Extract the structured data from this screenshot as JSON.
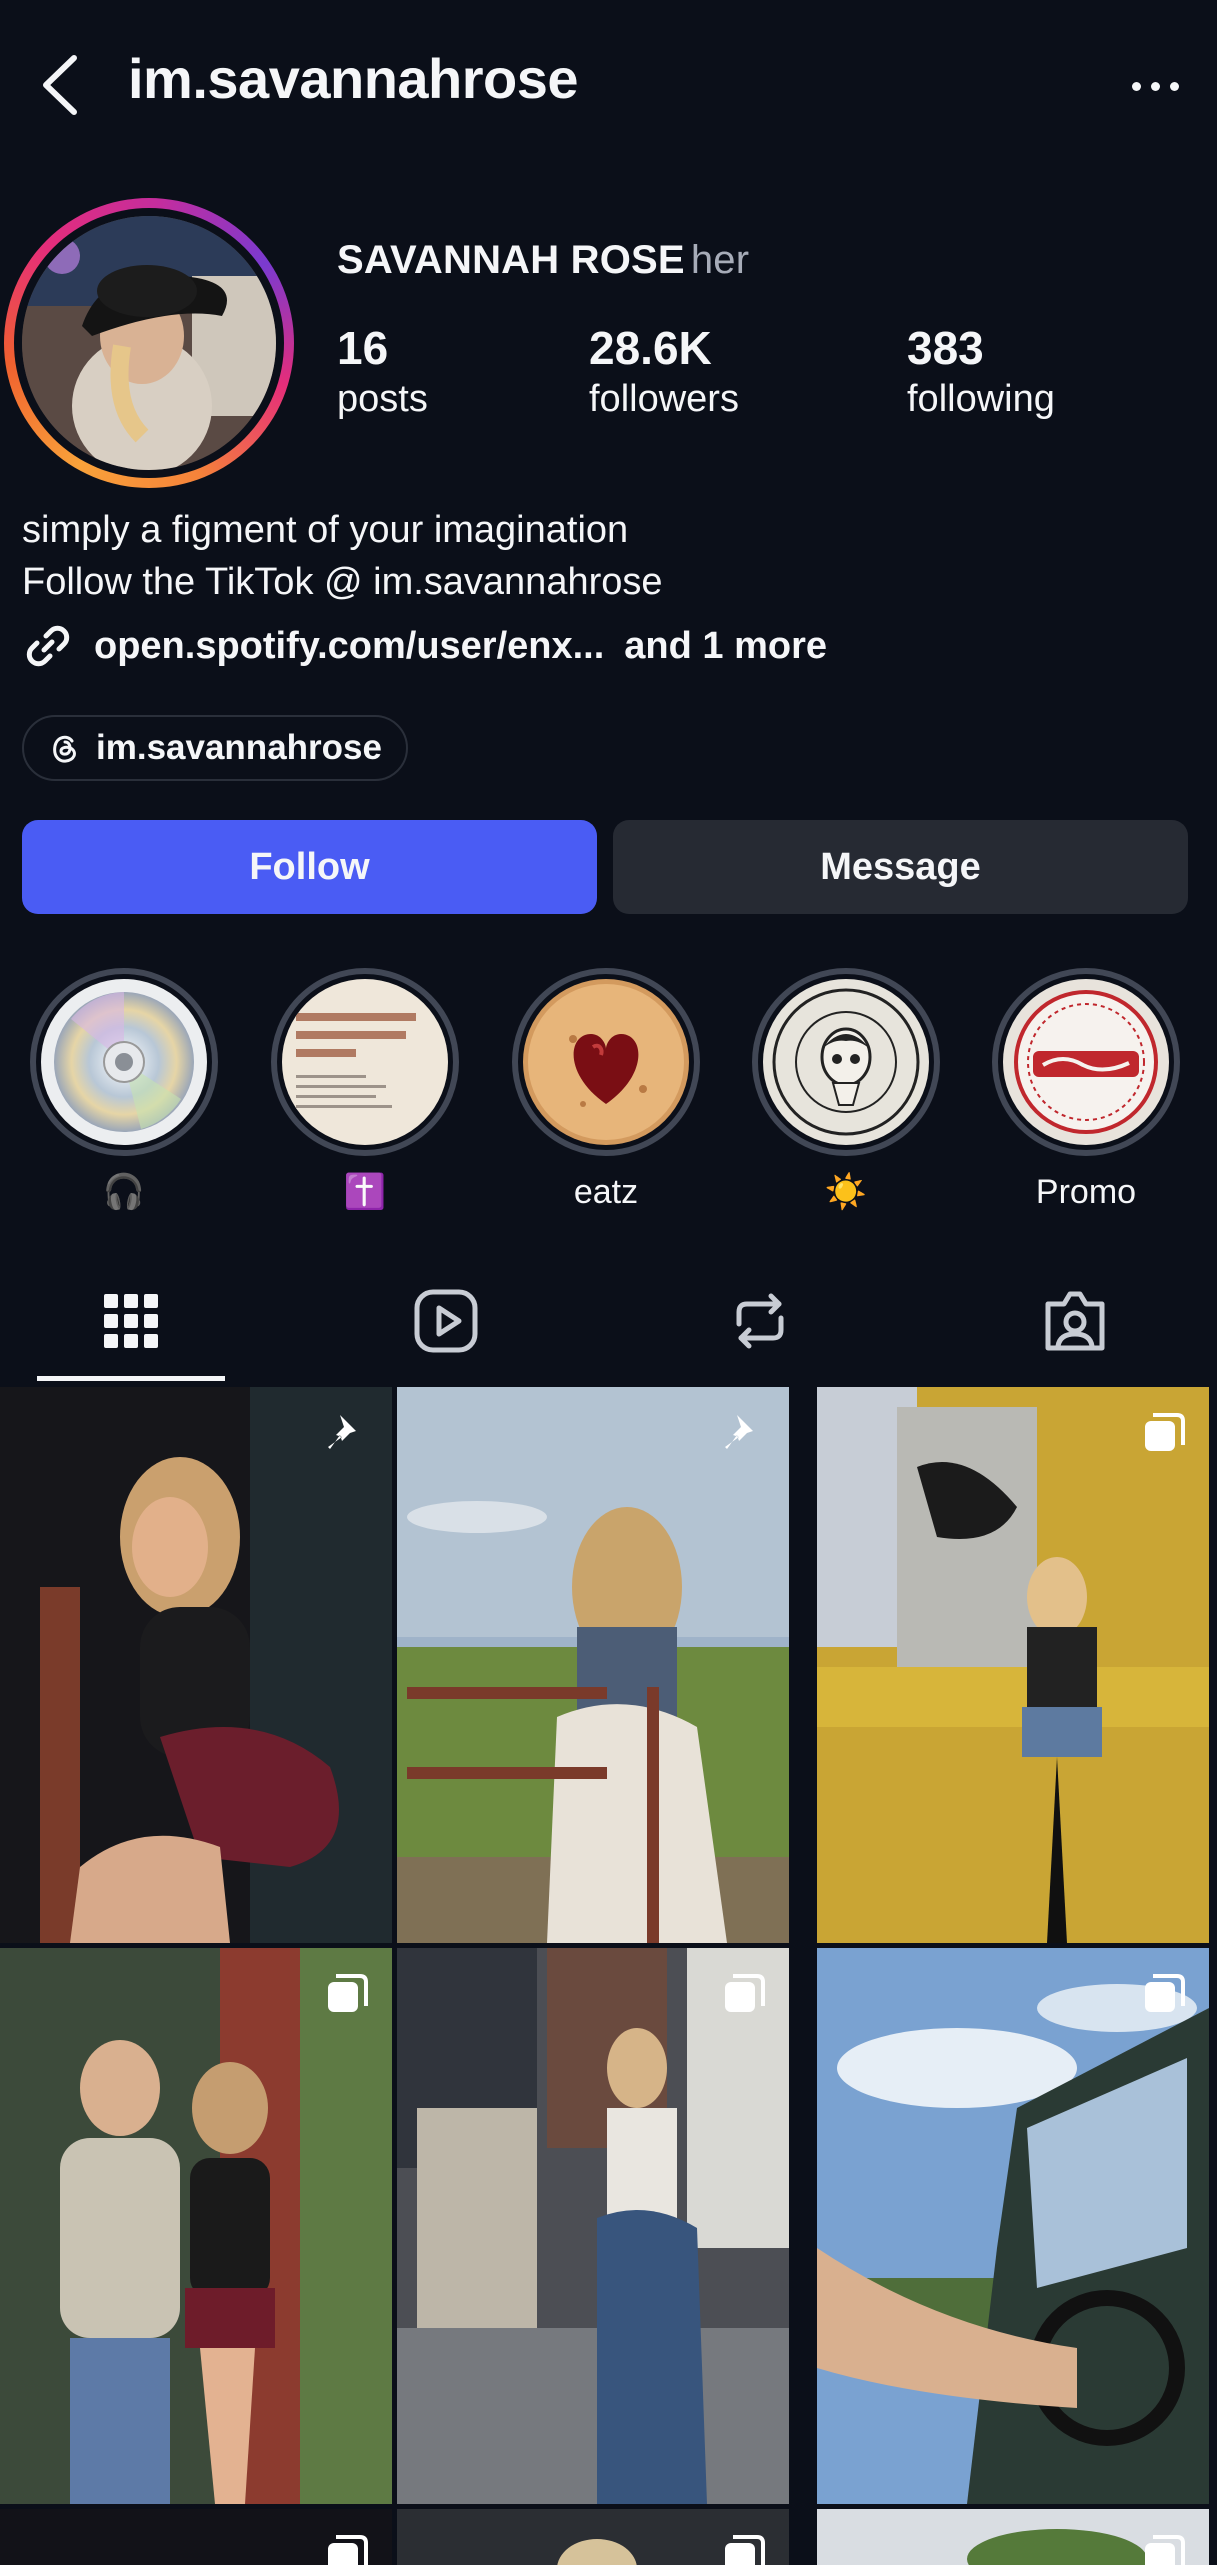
{
  "header": {
    "username": "im.savannahrose"
  },
  "profile": {
    "display_name": "SAVANNAH ROSE",
    "pronouns": "her",
    "stats": {
      "posts": {
        "value": "16",
        "label": "posts"
      },
      "followers": {
        "value": "28.6K",
        "label": "followers"
      },
      "following": {
        "value": "383",
        "label": "following"
      }
    },
    "bio_lines": [
      "simply a figment of your imagination",
      "Follow the TikTok @ im.savannahrose"
    ],
    "link": {
      "text": "open.spotify.com/user/enx...",
      "more": "and 1 more"
    },
    "threads_handle": "im.savannahrose"
  },
  "actions": {
    "follow_label": "Follow",
    "message_label": "Message"
  },
  "highlights": [
    {
      "label": "🎧",
      "icon": "cd-disc"
    },
    {
      "label": "✝️",
      "icon": "quote-card"
    },
    {
      "label": "eatz",
      "icon": "heart-cookie"
    },
    {
      "label": "☀️",
      "icon": "life-is-only-one-badge"
    },
    {
      "label": "Promo",
      "icon": "coca-cola-cap"
    }
  ],
  "tabs": [
    {
      "name": "grid-icon",
      "active": true
    },
    {
      "name": "reels-icon",
      "active": false
    },
    {
      "name": "reposts-icon",
      "active": false
    },
    {
      "name": "tagged-icon",
      "active": false
    }
  ],
  "posts": [
    {
      "badge": "pin-icon"
    },
    {
      "badge": "pin-icon"
    },
    {
      "badge": "carousel-icon"
    },
    {
      "badge": "carousel-icon"
    },
    {
      "badge": "carousel-icon"
    },
    {
      "badge": "carousel-icon"
    },
    {
      "badge": "carousel-icon"
    },
    {
      "badge": "carousel-icon"
    },
    {
      "badge": "carousel-icon"
    }
  ],
  "colors": {
    "background": "#0b0f19",
    "follow_button": "#4a5cf4",
    "message_button": "#262a33",
    "text": "#f5f6f8",
    "muted_text": "#a7acb8"
  }
}
